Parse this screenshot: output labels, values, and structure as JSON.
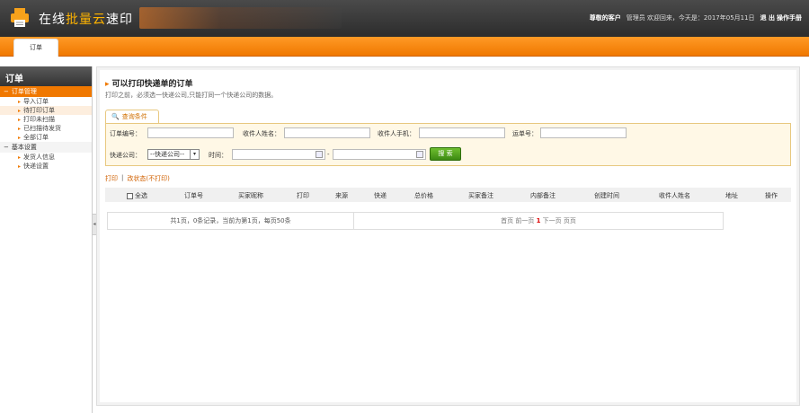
{
  "header": {
    "brand_prefix": "在线",
    "brand_highlight": "批量云",
    "brand_suffix": "速印",
    "greeting": "尊敬的客户",
    "user_line": "管理员 欢迎回来，今天是：2017年05月11日",
    "logout": "退 出",
    "manual": "操作手册"
  },
  "nav": {
    "tab": "订单"
  },
  "sidebar": {
    "title": "订单",
    "groups": [
      {
        "label": "订单管理",
        "items": [
          "导入订单",
          "待打印订单",
          "打印未扫描",
          "已扫描待发货",
          "全部订单"
        ]
      },
      {
        "label": "基本设置",
        "items": [
          "发货人信息",
          "快递设置"
        ]
      }
    ]
  },
  "main": {
    "title": "可以打印快递单的订单",
    "subtitle": "打印之前，必须选一快递公司,只能打同一个快递公司的数据。",
    "query_tab": "查询条件",
    "fields": {
      "order_no": "订单编号：",
      "receiver_name": "收件人姓名：",
      "receiver_phone": "收件人手机：",
      "waybill_no": "运单号：",
      "express_company": "快递公司：",
      "express_selected": "--快递公司--",
      "time": "时间：",
      "dash": "-",
      "search": "搜 索"
    },
    "links": {
      "print": "打印",
      "sep": "|",
      "change_status": "改状态(不打印)"
    },
    "table": {
      "select_all": "全选",
      "columns": [
        "订单号",
        "买家昵称",
        "打印",
        "来源",
        "快递",
        "总价格",
        "买家备注",
        "内部备注",
        "创建时间",
        "收件人姓名",
        "地址",
        "操作"
      ]
    },
    "pager": {
      "summary": "共1页，0条记录，当前为第1页，每页50条",
      "first": "首页",
      "prev": "前一页",
      "current": "1",
      "next": "下一页",
      "last": "页页"
    }
  }
}
